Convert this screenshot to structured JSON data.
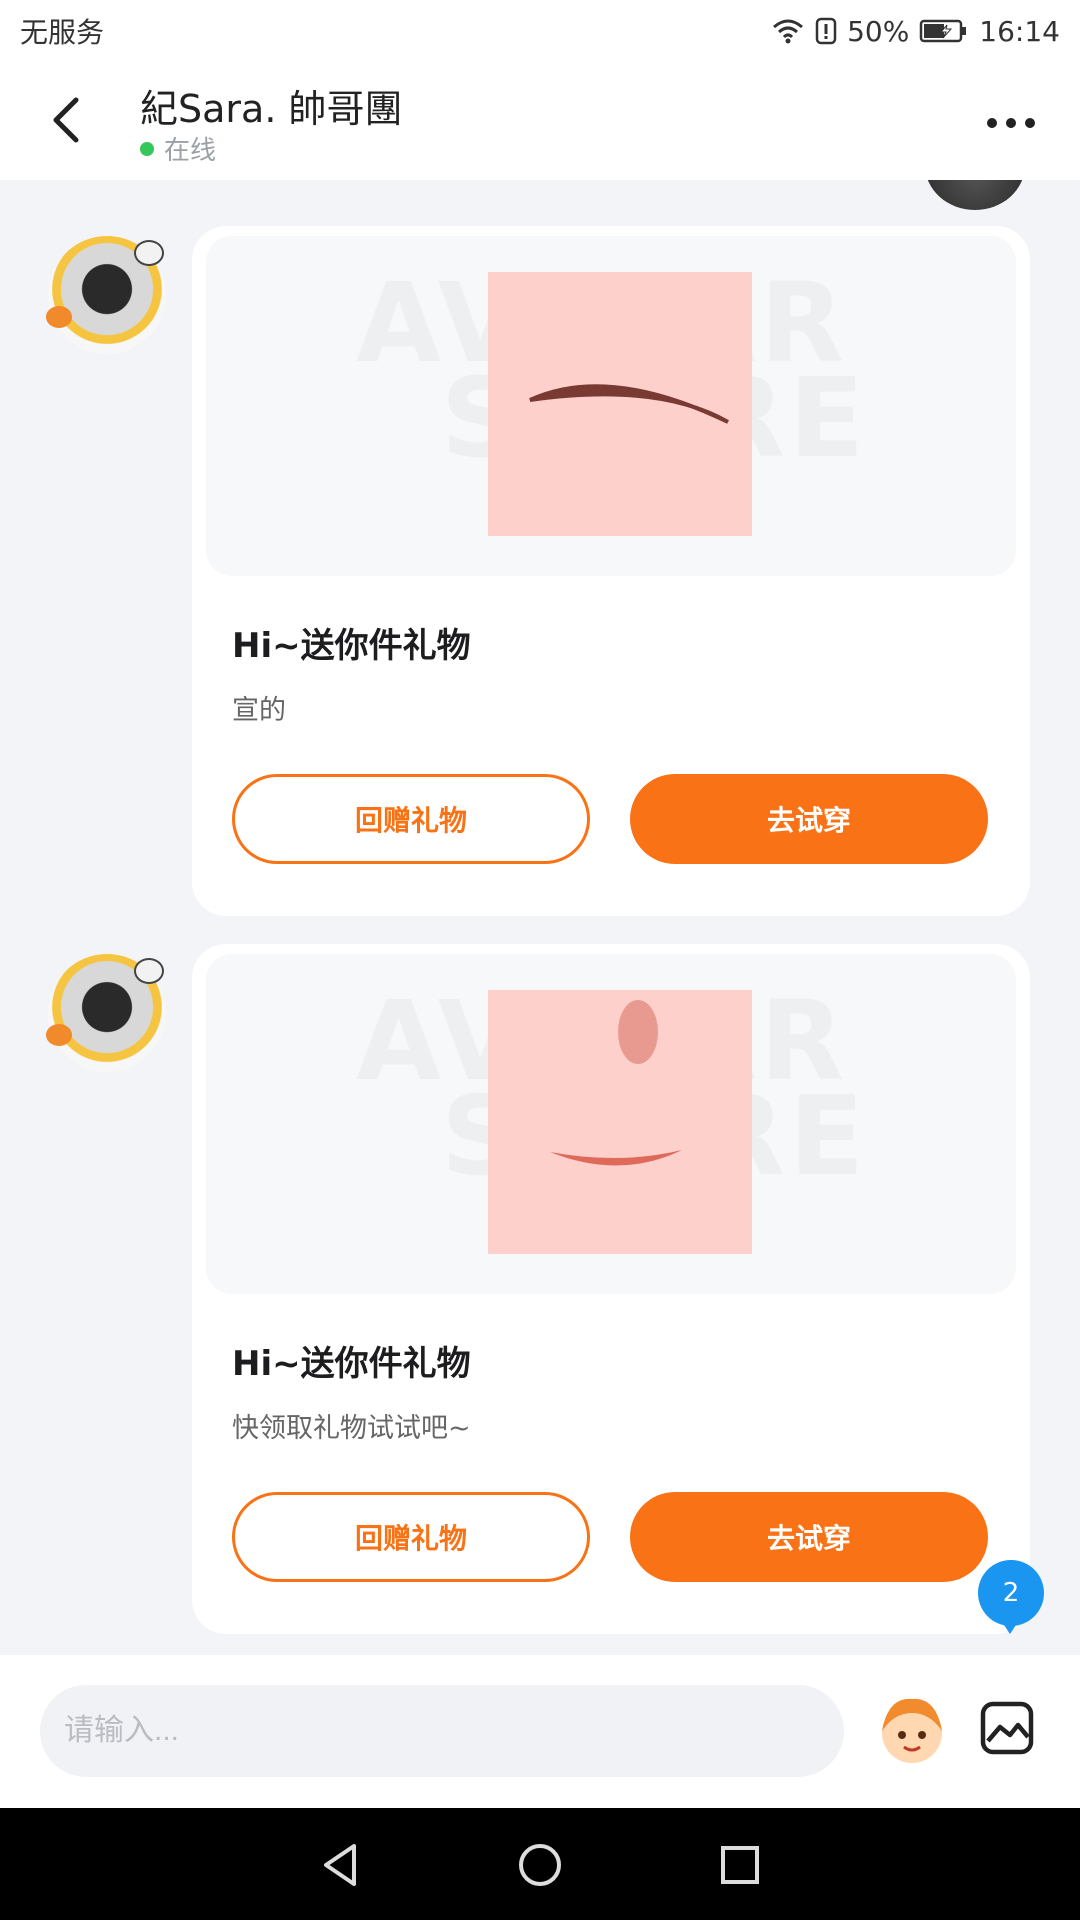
{
  "status_bar": {
    "carrier": "无服务",
    "battery_percent": "50%",
    "time": "16:14",
    "icons": [
      "wifi-icon",
      "alert-icon",
      "battery-charging-icon"
    ]
  },
  "header": {
    "title": "紀Sara.  帥哥團",
    "status": "在线",
    "status_color": "#34c759",
    "back_icon": "chevron-left-icon",
    "more_icon": "more-horizontal-icon"
  },
  "messages": [
    {
      "gift_title": "Hi~送你件礼物",
      "gift_desc": "宣的",
      "return_gift_label": "回赠礼物",
      "try_on_label": "去试穿",
      "preview_item": "eyebrow"
    },
    {
      "gift_title": "Hi~送你件礼物",
      "gift_desc": "快领取礼物试试吧~",
      "return_gift_label": "回赠礼物",
      "try_on_label": "去试穿",
      "preview_item": "mouth"
    }
  ],
  "unread_badge": "2",
  "input": {
    "placeholder": "请输入..."
  },
  "colors": {
    "accent": "#f97316",
    "badge": "#1a96f0"
  }
}
